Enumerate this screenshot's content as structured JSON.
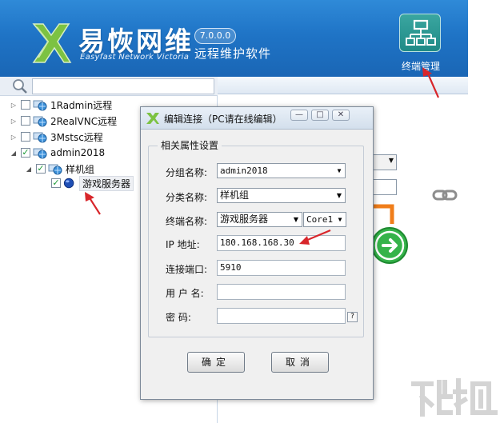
{
  "header": {
    "brand_title": "易恢网维",
    "brand_subtitle": "Easyfast Network Victoria",
    "version": "7.0.0.0",
    "product_name": "远程维护软件",
    "terminal_manage_label": "终端管理"
  },
  "search": {
    "value": "",
    "placeholder": ""
  },
  "tree": {
    "items": [
      {
        "label": "1Radmin远程",
        "checked": false,
        "expander": "▷"
      },
      {
        "label": "2RealVNC远程",
        "checked": false,
        "expander": "▷"
      },
      {
        "label": "3Mstsc远程",
        "checked": false,
        "expander": "▷"
      },
      {
        "label": "admin2018",
        "checked": true,
        "expander": "◢"
      },
      {
        "label": "样机组",
        "checked": true,
        "expander": "◢"
      },
      {
        "label": "游戏服务器",
        "checked": true,
        "expander": ""
      }
    ]
  },
  "dialog": {
    "title": "编辑连接（PC请在线编辑）",
    "min_label": "—",
    "max_label": "□",
    "close_label": "✕",
    "group_title": "相关属性设置",
    "fields": {
      "group_name_label": "分组名称:",
      "group_name_value": "admin2018",
      "category_label": "分类名称:",
      "category_value": "样机组",
      "terminal_label": "终端名称:",
      "terminal_value": "游戏服务器",
      "core_value": "Core1",
      "ip_label": "IP  地址:",
      "ip_value": "180.168.168.30",
      "port_label": "连接端口:",
      "port_value": "5910",
      "user_label": "用 户 名:",
      "user_value": "",
      "password_label": "密    码:",
      "password_value": "",
      "help_label": "?"
    },
    "ok_label": "确定",
    "cancel_label": "取消"
  },
  "colors": {
    "header_blue": "#1f74c6",
    "accent_green": "#35b34a",
    "arrow_red": "#d8262b",
    "orange": "#f07d1a"
  },
  "icons": {
    "logo": "brand-x-logo-icon",
    "terminal": "network-tree-icon",
    "search": "magnifier-icon",
    "node": "computer-globe-icon",
    "leaf": "blue-orb-icon",
    "link": "chain-link-icon",
    "go": "green-arrow-icon"
  }
}
